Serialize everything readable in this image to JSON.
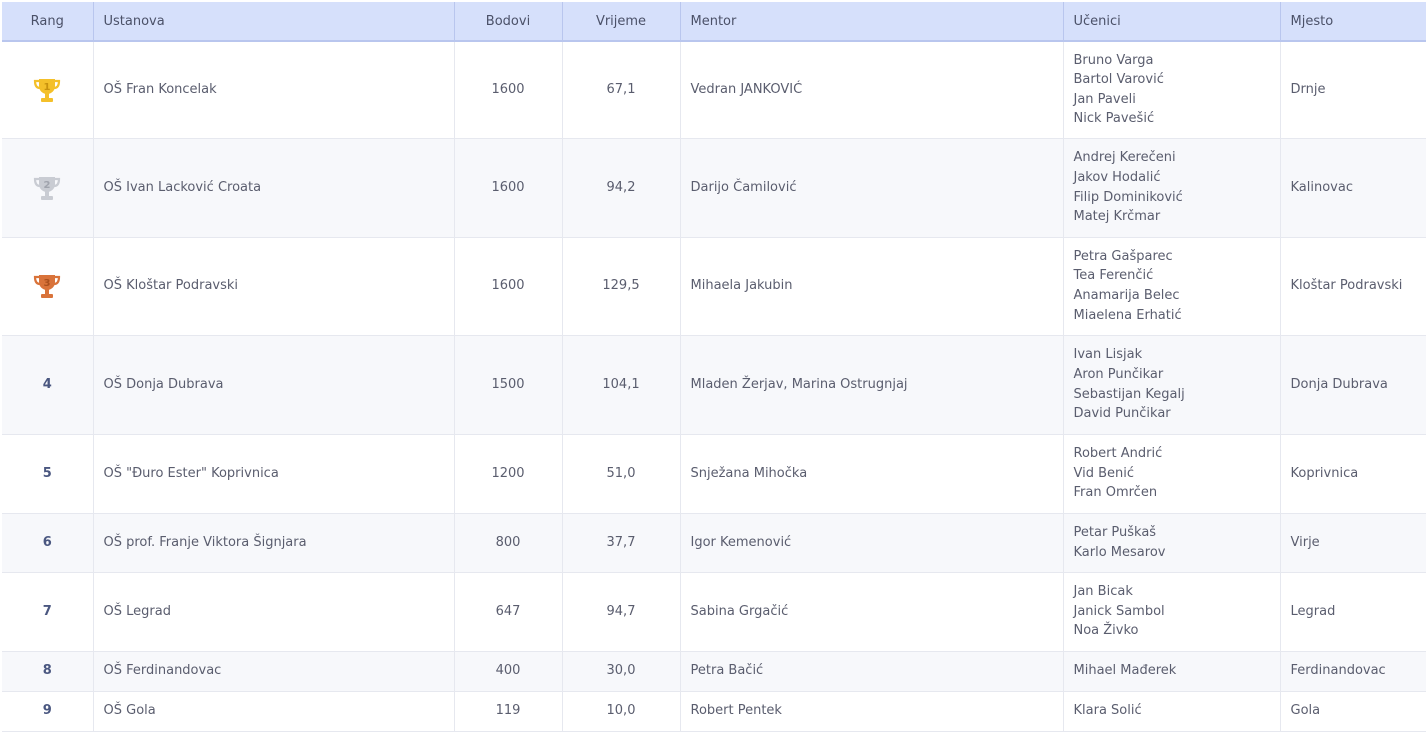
{
  "headers": {
    "rank": "Rang",
    "institution": "Ustanova",
    "points": "Bodovi",
    "time": "Vrijeme",
    "mentor": "Mentor",
    "students": "Učenici",
    "place": "Mjesto"
  },
  "colors": {
    "header_bg": "#d6e0fb",
    "gold": "#f4c02a",
    "silver": "#c9ccd3",
    "bronze": "#d9733a"
  },
  "rows": [
    {
      "rank": "1",
      "trophy": "gold-trophy-icon",
      "institution": "OŠ Fran Koncelak",
      "points": "1600",
      "time": "67,1",
      "mentor": "Vedran JANKOVIĆ",
      "students": [
        "Bruno Varga",
        "Bartol Varović",
        "Jan Paveli",
        "Nick Pavešić"
      ],
      "place": "Drnje"
    },
    {
      "rank": "2",
      "trophy": "silver-trophy-icon",
      "institution": "OŠ Ivan Lacković Croata",
      "points": "1600",
      "time": "94,2",
      "mentor": "Darijo Čamilović",
      "students": [
        "Andrej Kerečeni",
        "Jakov Hodalić",
        "Filip Dominiković",
        "Matej Krčmar"
      ],
      "place": "Kalinovac"
    },
    {
      "rank": "3",
      "trophy": "bronze-trophy-icon",
      "institution": "OŠ Kloštar Podravski",
      "points": "1600",
      "time": "129,5",
      "mentor": "Mihaela Jakubin",
      "students": [
        "Petra Gašparec",
        "Tea Ferenčić",
        "Anamarija Belec",
        "Miaelena Erhatić"
      ],
      "place": "Kloštar Podravski"
    },
    {
      "rank": "4",
      "institution": "OŠ Donja Dubrava",
      "points": "1500",
      "time": "104,1",
      "mentor": "Mladen Žerjav, Marina Ostrugnjaj",
      "students": [
        "Ivan Lisjak",
        "Aron Punčikar",
        "Sebastijan Kegalj",
        "David Punčikar"
      ],
      "place": "Donja Dubrava"
    },
    {
      "rank": "5",
      "institution": "OŠ \"Đuro Ester\" Koprivnica",
      "points": "1200",
      "time": "51,0",
      "mentor": "Snježana Mihočka",
      "students": [
        "Robert Andrić",
        "Vid Benić",
        "Fran Omrčen"
      ],
      "place": "Koprivnica"
    },
    {
      "rank": "6",
      "institution": "OŠ prof. Franje Viktora Šignjara",
      "points": "800",
      "time": "37,7",
      "mentor": "Igor Kemenović",
      "students": [
        "Petar Puškaš",
        "Karlo Mesarov"
      ],
      "place": "Virje"
    },
    {
      "rank": "7",
      "institution": "OŠ Legrad",
      "points": "647",
      "time": "94,7",
      "mentor": "Sabina Grgačić",
      "students": [
        "Jan Bicak",
        "Janick Sambol",
        "Noa Živko"
      ],
      "place": "Legrad"
    },
    {
      "rank": "8",
      "institution": "OŠ Ferdinandovac",
      "points": "400",
      "time": "30,0",
      "mentor": "Petra Bačić",
      "students": [
        "Mihael Mađerek"
      ],
      "place": "Ferdinandovac"
    },
    {
      "rank": "9",
      "institution": "OŠ Gola",
      "points": "119",
      "time": "10,0",
      "mentor": "Robert Pentek",
      "students": [
        "Klara Solić"
      ],
      "place": "Gola"
    }
  ]
}
